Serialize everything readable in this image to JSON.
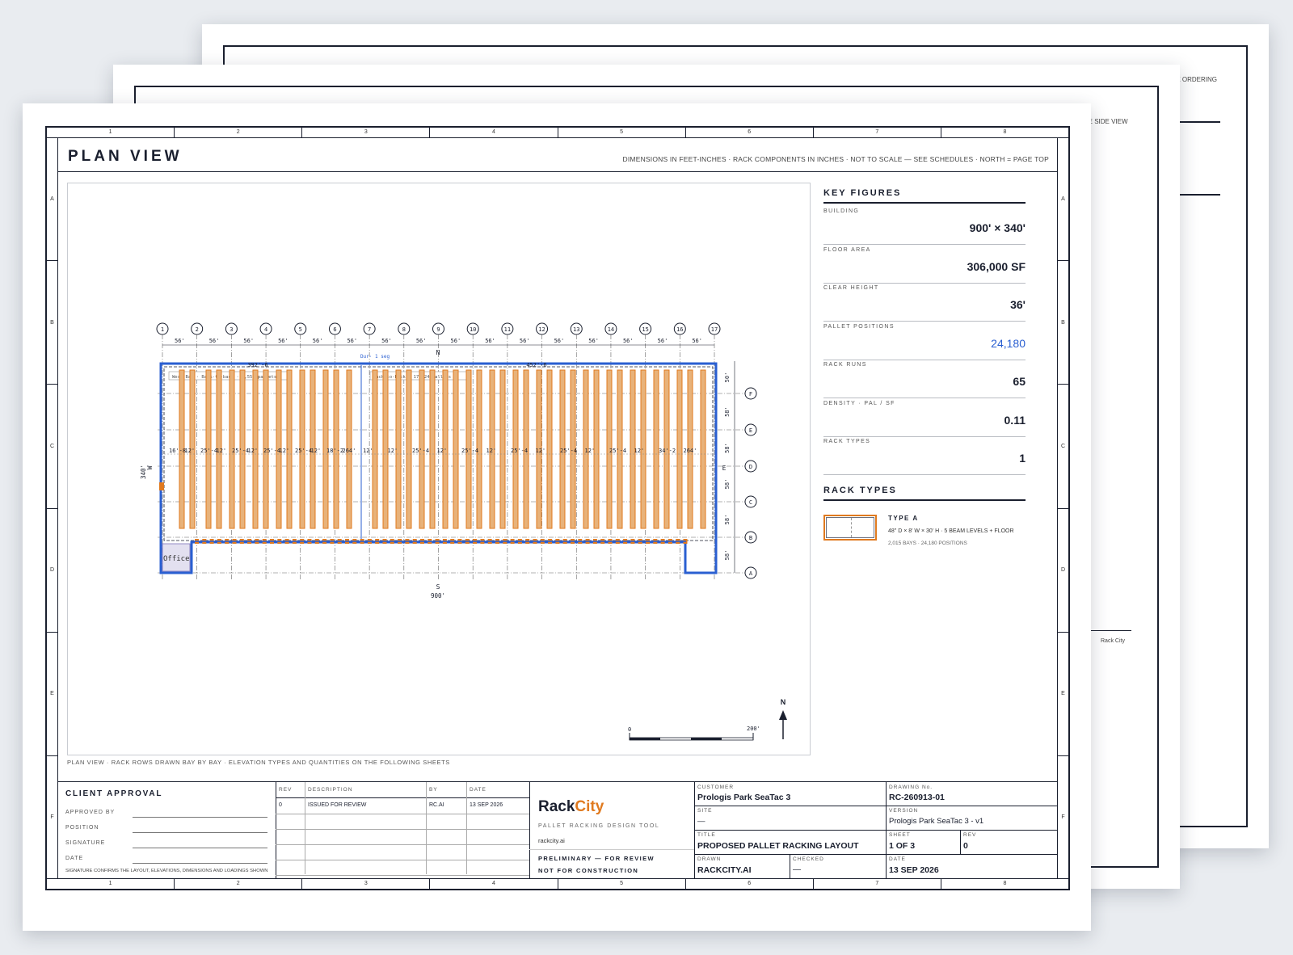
{
  "zones": {
    "numbers": [
      "1",
      "2",
      "3",
      "4",
      "5",
      "6",
      "7",
      "8"
    ],
    "letters": [
      "A",
      "B",
      "C",
      "D",
      "E",
      "F"
    ]
  },
  "back_sheets": {
    "sheet3_label": "PE ORDERING",
    "sheet2_label": "ME SIDE VIEW",
    "sheet2_foot": "Rack City"
  },
  "header": {
    "title": "PLAN VIEW",
    "note": "DIMENSIONS IN FEET-INCHES · RACK COMPONENTS IN INCHES · NOT TO SCALE — SEE SCHEDULES · NORTH = PAGE TOP"
  },
  "plan": {
    "grid_columns": [
      "1",
      "2",
      "3",
      "4",
      "5",
      "6",
      "7",
      "8",
      "9",
      "10",
      "11",
      "12",
      "13",
      "14",
      "15",
      "16",
      "17"
    ],
    "column_spacing": "56'",
    "grid_rows": [
      {
        "label": "F",
        "spacing": "50'"
      },
      {
        "label": "E",
        "spacing": "58'"
      },
      {
        "label": "D",
        "spacing": "58'"
      },
      {
        "label": "C",
        "spacing": "58'"
      },
      {
        "label": "B",
        "spacing": "58'"
      },
      {
        "label": "A",
        "spacing": "58'"
      }
    ],
    "north_label": "N",
    "south_label": "S",
    "east_label": "E",
    "west_label": "W",
    "width_dim": "900'",
    "height_dim": "340'",
    "top_dim_left": "392'-6",
    "top_dim_right": "452'-6",
    "top_dim_center": "Dur· 1 seg",
    "west_bay_label": "West Bay · Back-to-back · 6,556 pallets",
    "east_bay_label": "Back-to-back · 17,624 pallets",
    "aisle_dims": [
      "16'-8",
      "12'",
      "25'-4",
      "12'",
      "25'-4",
      "12'",
      "25'-4",
      "12'",
      "25'-4",
      "12'",
      "18'-2",
      "264'",
      "12'",
      "12'",
      "25'-4",
      "12'",
      "25'-4",
      "12'",
      "25'-4",
      "12'",
      "25'-4",
      "12'",
      "25'-4",
      "12'",
      "34'-2",
      "264'"
    ],
    "office_label": "Office",
    "scale_zero": "0",
    "scale_end": "200'",
    "compass": "N",
    "caption": "PLAN VIEW · RACK ROWS DRAWN BAY BY BAY · ELEVATION TYPES AND QUANTITIES ON THE FOLLOWING SHEETS"
  },
  "key_figures": {
    "heading": "KEY FIGURES",
    "items": [
      {
        "label": "BUILDING",
        "value": "900' × 340'"
      },
      {
        "label": "FLOOR AREA",
        "value": "306,000 SF"
      },
      {
        "label": "CLEAR HEIGHT",
        "value": "36'"
      },
      {
        "label": "PALLET POSITIONS",
        "value": "24,180"
      },
      {
        "label": "RACK RUNS",
        "value": "65"
      },
      {
        "label": "DENSITY · PAL / SF",
        "value": "0.11"
      },
      {
        "label": "RACK TYPES",
        "value": "1"
      }
    ],
    "accent": "#2a5fd1"
  },
  "rack_types": {
    "heading": "RACK TYPES",
    "type_name": "TYPE A",
    "type_spec": "48\" D × 8' W × 30' H · 5 BEAM LEVELS + FLOOR",
    "type_detail": "2,015 BAYS · 24,180 POSITIONS"
  },
  "client_approval": {
    "heading": "CLIENT APPROVAL",
    "fields": [
      "APPROVED BY",
      "POSITION",
      "SIGNATURE",
      "DATE"
    ],
    "note": "SIGNATURE CONFIRMS THE LAYOUT, ELEVATIONS, DIMENSIONS AND LOADINGS SHOWN"
  },
  "revisions": {
    "headers": [
      "REV",
      "DESCRIPTION",
      "BY",
      "DATE"
    ],
    "rows": [
      [
        "0",
        "ISSUED FOR REVIEW",
        "RC.AI",
        "13 SEP 2026"
      ]
    ]
  },
  "brand": {
    "name_a": "Rack",
    "name_b": "City",
    "tagline": "PALLET RACKING DESIGN TOOL",
    "url": "rackcity.ai",
    "status1": "PRELIMINARY — FOR REVIEW",
    "status2": "NOT FOR CONSTRUCTION",
    "accent": "#e07a1f"
  },
  "title_block": {
    "customer_label": "CUSTOMER",
    "customer": "Prologis Park SeaTac 3",
    "drawing_label": "DRAWING No.",
    "drawing": "RC-260913-01",
    "site_label": "SITE",
    "site": "—",
    "version_label": "VERSION",
    "version": "Prologis Park SeaTac 3 - v1",
    "title_label": "TITLE",
    "title": "PROPOSED PALLET RACKING LAYOUT",
    "sheet_label": "SHEET",
    "sheet": "1 OF 3",
    "rev_label": "REV",
    "rev": "0",
    "drawn_label": "DRAWN",
    "drawn": "RACKCITY.AI",
    "checked_label": "CHECKED",
    "checked": "—",
    "date_label": "DATE",
    "date": "13 SEP 2026"
  }
}
